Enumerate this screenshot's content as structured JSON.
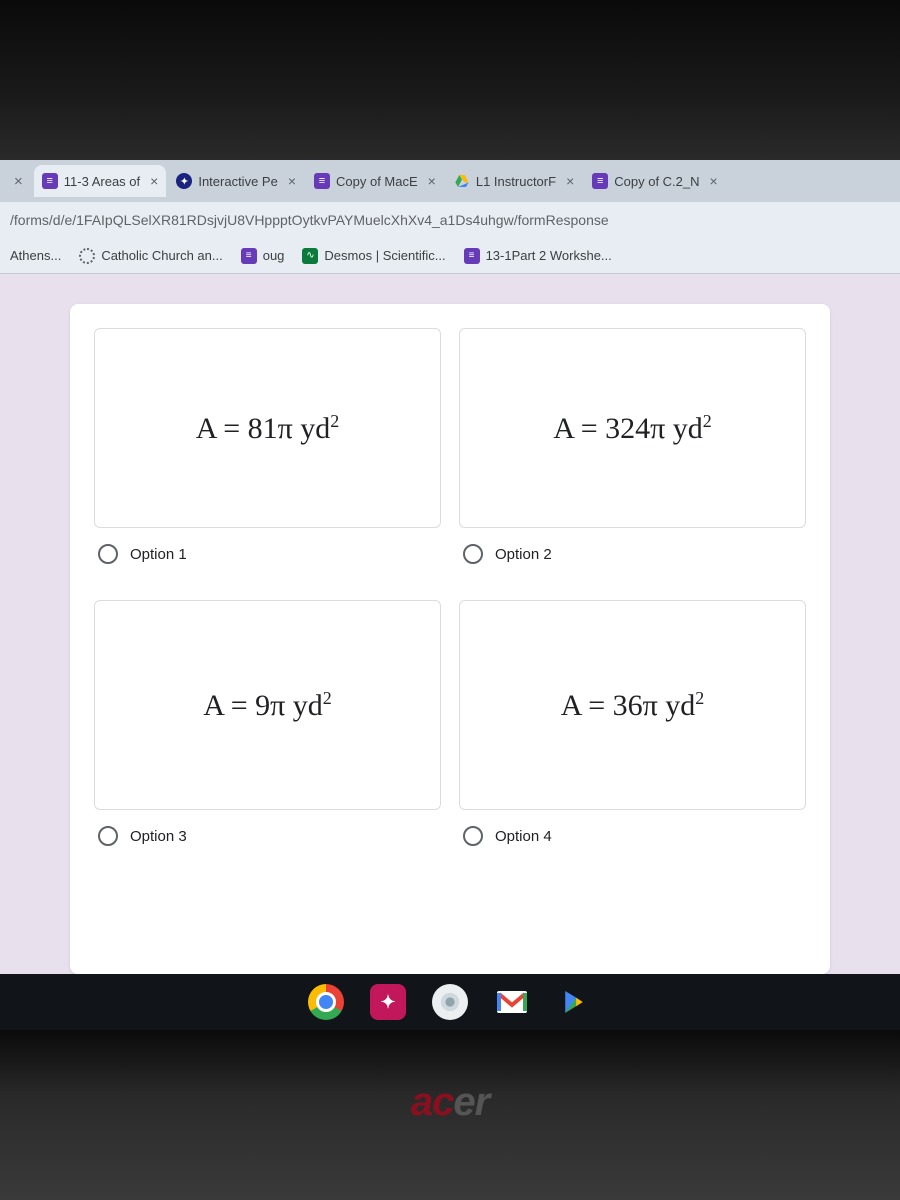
{
  "tabs": {
    "t1": "11-3 Areas of",
    "t2": "Interactive Pe",
    "t3": "Copy of MacE",
    "t4": "L1 InstructorF",
    "t5": "Copy of C.2_N"
  },
  "url": "/forms/d/e/1FAIpQLSelXR81RDsjvjU8VHppptOytkvPAYMuelcXhXv4_a1Ds4uhgw/formResponse",
  "bookmarks": {
    "b1": "Athens...",
    "b2": "Catholic Church an...",
    "b3": "oug",
    "b4": "Desmos | Scientific...",
    "b5": "13-1Part 2 Workshe..."
  },
  "options": {
    "o1": {
      "formula_a": "A = 81π yd",
      "label": "Option 1"
    },
    "o2": {
      "formula_a": "A = 324π yd",
      "label": "Option 2"
    },
    "o3": {
      "formula_a": "A = 9π yd",
      "label": "Option 3"
    },
    "o4": {
      "formula_a": "A = 36π yd",
      "label": "Option 4"
    }
  },
  "brand": {
    "a": "ac",
    "b": "er"
  }
}
